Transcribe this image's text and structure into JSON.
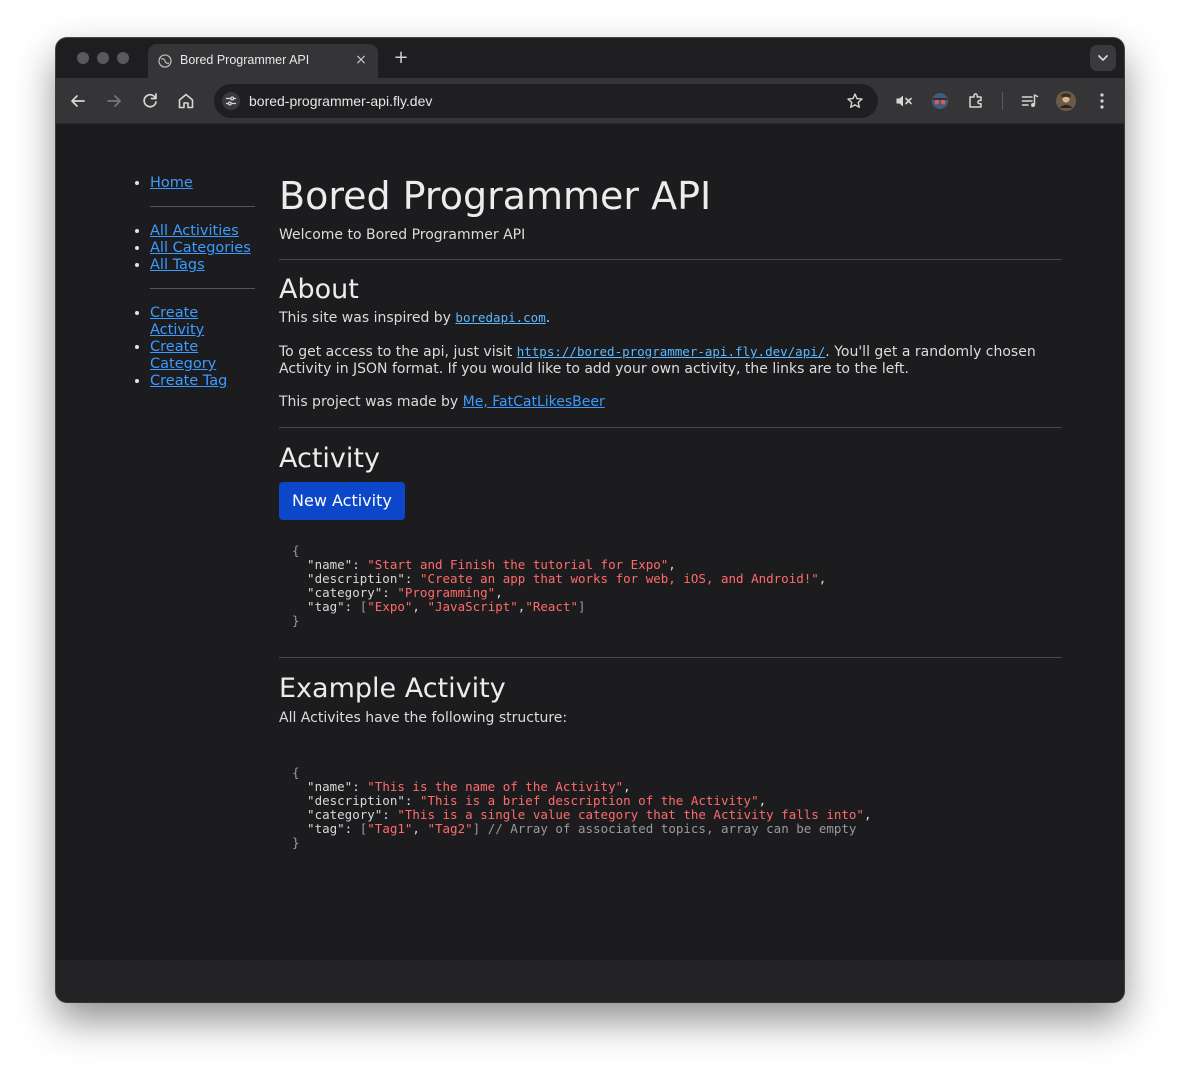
{
  "browser": {
    "tab_title": "Bored Programmer API",
    "tab_close": "×",
    "new_tab": "+",
    "url": "bored-programmer-api.fly.dev",
    "icons": [
      "back-icon",
      "forward-icon",
      "reload-icon",
      "home-icon",
      "site-info-icon",
      "bookmark-star-icon",
      "mute-icon",
      "spy-extension-icon",
      "extensions-icon",
      "media-icon",
      "profile-avatar-icon",
      "menu-icon"
    ]
  },
  "sidebar": {
    "home": "Home",
    "group1": [
      "All Activities",
      "All Categories",
      "All Tags"
    ],
    "group2": [
      "Create Activity",
      "Create Category",
      "Create Tag"
    ]
  },
  "main": {
    "title": "Bored Programmer API",
    "welcome": "Welcome to Bored Programmer API",
    "about": {
      "heading": "About",
      "p1_prefix": "This site was inspired by ",
      "p1_code": "boredapi.com",
      "p1_suffix": ".",
      "p2_prefix": "To get access to the api, just visit ",
      "p2_code": "https://bored-programmer-api.fly.dev/api/",
      "p2_suffix": ". You'll get a randomly chosen Activity in JSON format. If you would like to add your own activity, the links are to the left.",
      "p3_prefix": "This project was made by ",
      "p3_link": "Me, FatCatLikesBeer"
    },
    "activity": {
      "heading": "Activity",
      "button": "New Activity",
      "json": {
        "name": "\"Start and Finish the tutorial for Expo\"",
        "description": "\"Create an app that works for web, iOS, and Android!\"",
        "category": "\"Programming\"",
        "tag_1": "\"Expo\"",
        "tag_2": "\"JavaScript\"",
        "tag_3": "\"React\""
      }
    },
    "example": {
      "heading": "Example Activity",
      "intro": "All Activites have the following structure:",
      "json": {
        "name": "\"This is the name of the Activity\"",
        "description": "\"This is a brief description of the Activity\"",
        "category": "\"This is a single value category that the Activity falls into\"",
        "tag_1": "\"Tag1\"",
        "tag_2": "\"Tag2\"",
        "comment": "// Array of associated topics, array can be empty"
      }
    }
  }
}
